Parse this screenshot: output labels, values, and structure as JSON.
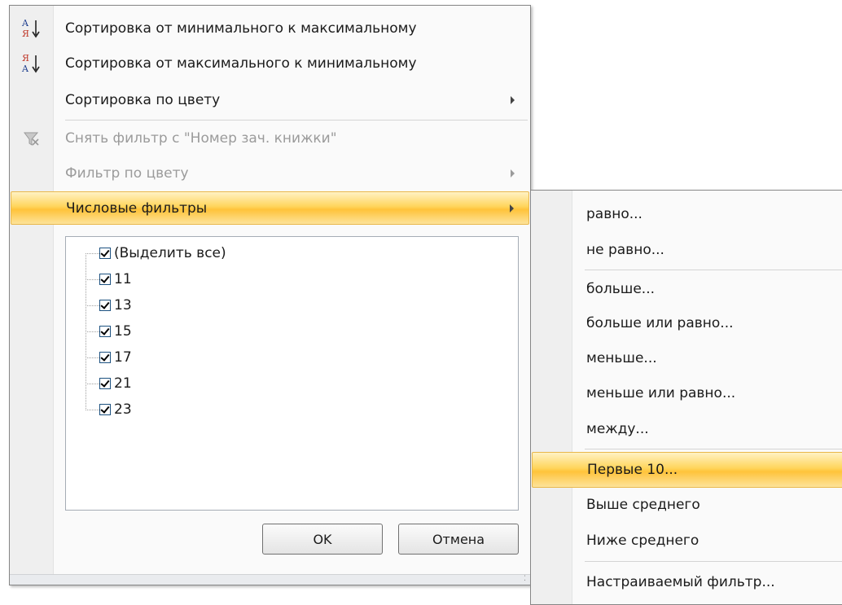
{
  "filter_menu": {
    "items": [
      {
        "label": "Сортировка от минимального к максимальному",
        "icon": "sort-ascending-icon"
      },
      {
        "label": "Сортировка от максимального к минимальному",
        "icon": "sort-descending-icon"
      },
      {
        "label": "Сортировка по цвету"
      },
      {
        "label": "Снять фильтр с \"Номер зач. книжки\"",
        "icon": "clear-filter-icon",
        "disabled": true
      },
      {
        "label": "Фильтр по цвету",
        "disabled": true
      },
      {
        "label": "Числовые фильтры",
        "highlighted": true
      }
    ],
    "values": [
      {
        "label": "(Выделить все)",
        "checked": true
      },
      {
        "label": "11",
        "checked": true
      },
      {
        "label": "13",
        "checked": true
      },
      {
        "label": "15",
        "checked": true
      },
      {
        "label": "17",
        "checked": true
      },
      {
        "label": "21",
        "checked": true
      },
      {
        "label": "23",
        "checked": true
      }
    ],
    "ok_label": "OK",
    "cancel_label": "Отмена"
  },
  "number_filters_menu": {
    "items": [
      {
        "label": "равно..."
      },
      {
        "label": "не равно..."
      },
      {
        "label": "больше..."
      },
      {
        "label": "больше или равно..."
      },
      {
        "label": "меньше..."
      },
      {
        "label": "меньше или равно..."
      },
      {
        "label": "между..."
      },
      {
        "label": "Первые 10...",
        "highlighted": true
      },
      {
        "label": "Выше среднего"
      },
      {
        "label": "Ниже среднего"
      },
      {
        "label": "Настраиваемый фильтр..."
      }
    ]
  },
  "colors": {
    "highlight": "#ffd55c",
    "menu_background": "#fafafa",
    "gutter": "#efefef",
    "disabled_text": "#9b9b9b"
  }
}
